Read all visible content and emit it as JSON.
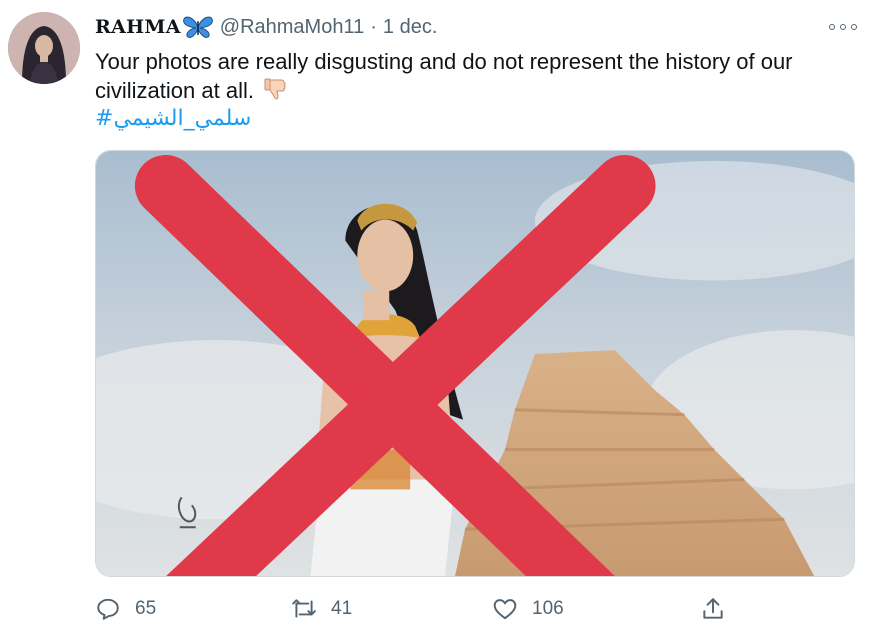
{
  "tweet": {
    "display_name": "RAHMA",
    "handle": "@RahmaMoh11",
    "separator": "·",
    "date": "1 dec.",
    "text": "Your photos are really disgusting and do not represent the history of our civilization at all.",
    "hashtag": "#سلمي_الشيمي",
    "media_alt": "Photo of a woman in ancient Egyptian costume in front of a step pyramid, crossed out with a large red X",
    "icons": {
      "name_emoji": "butterfly-icon",
      "text_emoji": "thumbs-down-icon",
      "more": "more-options-icon"
    }
  },
  "actions": {
    "reply_count": "65",
    "retweet_count": "41",
    "like_count": "106",
    "share_icon": "share-icon"
  },
  "colors": {
    "link": "#1d9bf0",
    "secondary_text": "#536471",
    "cross": "#e0394a"
  }
}
